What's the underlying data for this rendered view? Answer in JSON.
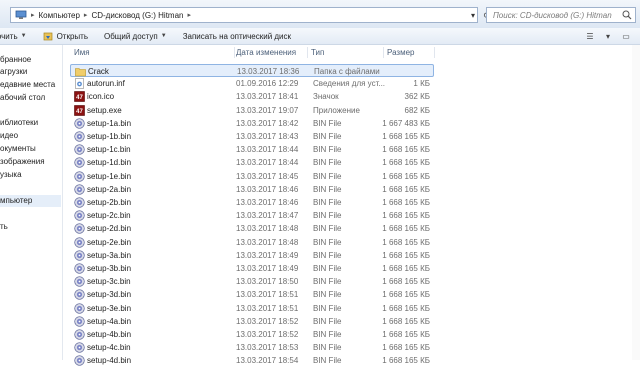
{
  "address": {
    "crumbs": [
      "Компьютер",
      "CD-дисковод (G:) Hitman"
    ],
    "search_placeholder": "Поиск: CD-дисковод (G:) Hitman"
  },
  "toolbar": {
    "organize": "Упорядочить",
    "open": "Открыть",
    "share": "Общий доступ",
    "burn": "Записать на оптический диск"
  },
  "sidebar": {
    "items": [
      "бранное",
      "агрузки",
      "едавние места",
      "абочий стол",
      "иблиотеки",
      "идео",
      "окументы",
      "зображения",
      "узыка",
      "мпьютер",
      "ть"
    ]
  },
  "columns": {
    "name": "Имя",
    "date": "Дата изменения",
    "type": "Тип",
    "size": "Размер"
  },
  "files": [
    {
      "icon": "folder-icon",
      "name": "Crack",
      "date": "13.03.2017 18:36",
      "type": "Папка с файлами",
      "size": "",
      "selected": true
    },
    {
      "icon": "gear-file-icon",
      "name": "autorun.inf",
      "date": "01.09.2016 12:29",
      "type": "Сведения для уст...",
      "size": "1 КБ"
    },
    {
      "icon": "hitman-icon",
      "name": "icon.ico",
      "date": "13.03.2017 18:41",
      "type": "Значок",
      "size": "362 КБ"
    },
    {
      "icon": "hitman-icon",
      "name": "setup.exe",
      "date": "13.03.2017 19:07",
      "type": "Приложение",
      "size": "682 КБ"
    },
    {
      "icon": "bin-file-icon",
      "name": "setup-1a.bin",
      "date": "13.03.2017 18:42",
      "type": "BIN File",
      "size": "1 667 483 КБ"
    },
    {
      "icon": "bin-file-icon",
      "name": "setup-1b.bin",
      "date": "13.03.2017 18:43",
      "type": "BIN File",
      "size": "1 668 165 КБ"
    },
    {
      "icon": "bin-file-icon",
      "name": "setup-1c.bin",
      "date": "13.03.2017 18:44",
      "type": "BIN File",
      "size": "1 668 165 КБ"
    },
    {
      "icon": "bin-file-icon",
      "name": "setup-1d.bin",
      "date": "13.03.2017 18:44",
      "type": "BIN File",
      "size": "1 668 165 КБ"
    },
    {
      "icon": "bin-file-icon",
      "name": "setup-1e.bin",
      "date": "13.03.2017 18:45",
      "type": "BIN File",
      "size": "1 668 165 КБ"
    },
    {
      "icon": "bin-file-icon",
      "name": "setup-2a.bin",
      "date": "13.03.2017 18:46",
      "type": "BIN File",
      "size": "1 668 165 КБ"
    },
    {
      "icon": "bin-file-icon",
      "name": "setup-2b.bin",
      "date": "13.03.2017 18:46",
      "type": "BIN File",
      "size": "1 668 165 КБ"
    },
    {
      "icon": "bin-file-icon",
      "name": "setup-2c.bin",
      "date": "13.03.2017 18:47",
      "type": "BIN File",
      "size": "1 668 165 КБ"
    },
    {
      "icon": "bin-file-icon",
      "name": "setup-2d.bin",
      "date": "13.03.2017 18:48",
      "type": "BIN File",
      "size": "1 668 165 КБ"
    },
    {
      "icon": "bin-file-icon",
      "name": "setup-2e.bin",
      "date": "13.03.2017 18:48",
      "type": "BIN File",
      "size": "1 668 165 КБ"
    },
    {
      "icon": "bin-file-icon",
      "name": "setup-3a.bin",
      "date": "13.03.2017 18:49",
      "type": "BIN File",
      "size": "1 668 165 КБ"
    },
    {
      "icon": "bin-file-icon",
      "name": "setup-3b.bin",
      "date": "13.03.2017 18:49",
      "type": "BIN File",
      "size": "1 668 165 КБ"
    },
    {
      "icon": "bin-file-icon",
      "name": "setup-3c.bin",
      "date": "13.03.2017 18:50",
      "type": "BIN File",
      "size": "1 668 165 КБ"
    },
    {
      "icon": "bin-file-icon",
      "name": "setup-3d.bin",
      "date": "13.03.2017 18:51",
      "type": "BIN File",
      "size": "1 668 165 КБ"
    },
    {
      "icon": "bin-file-icon",
      "name": "setup-3e.bin",
      "date": "13.03.2017 18:51",
      "type": "BIN File",
      "size": "1 668 165 КБ"
    },
    {
      "icon": "bin-file-icon",
      "name": "setup-4a.bin",
      "date": "13.03.2017 18:52",
      "type": "BIN File",
      "size": "1 668 165 КБ"
    },
    {
      "icon": "bin-file-icon",
      "name": "setup-4b.bin",
      "date": "13.03.2017 18:52",
      "type": "BIN File",
      "size": "1 668 165 КБ"
    },
    {
      "icon": "bin-file-icon",
      "name": "setup-4c.bin",
      "date": "13.03.2017 18:53",
      "type": "BIN File",
      "size": "1 668 165 КБ"
    },
    {
      "icon": "bin-file-icon",
      "name": "setup-4d.bin",
      "date": "13.03.2017 18:54",
      "type": "BIN File",
      "size": "1 668 165 КБ"
    }
  ]
}
